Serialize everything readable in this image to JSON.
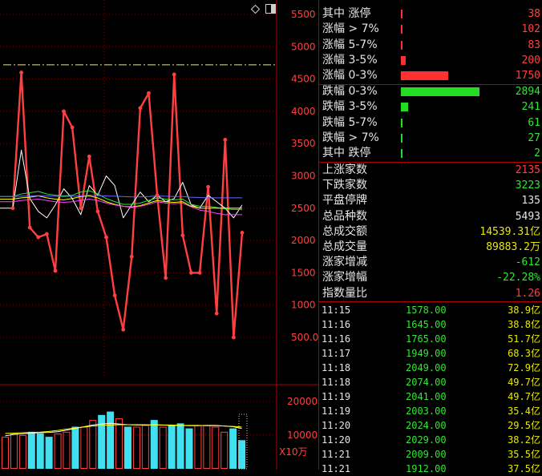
{
  "price_axis": {
    "ticks": [
      "5500",
      "5000",
      "4500",
      "4000",
      "3500",
      "3000",
      "2500",
      "2000",
      "1500",
      "1000",
      "500.0"
    ],
    "values": [
      5500,
      5000,
      4500,
      4000,
      3500,
      3000,
      2500,
      2000,
      1500,
      1000,
      500
    ]
  },
  "volume_axis": {
    "ticks": [
      "20000",
      "10000"
    ],
    "values": [
      20000,
      10000
    ],
    "unit": "X10万"
  },
  "toolbar": {
    "icon_diamond": "diamond-icon",
    "icon_window": "window-icon"
  },
  "chart_data": {
    "type": "line",
    "ylim": [
      0,
      5700
    ],
    "reference_line": 4720,
    "series": [
      {
        "color": "#ff4040",
        "values": [
          2500,
          4600,
          2200,
          2050,
          2100,
          1530,
          4000,
          3750,
          2500,
          3300,
          2450,
          2050,
          1150,
          620,
          1750,
          4050,
          4280,
          2700,
          1420,
          4570,
          2080,
          1500,
          1500,
          2830,
          870,
          3560,
          500,
          2120
        ]
      },
      {
        "color": "#ffffff",
        "values": [
          2500,
          3400,
          2650,
          2450,
          2350,
          2550,
          2800,
          2650,
          2400,
          2850,
          2700,
          3000,
          2850,
          2350,
          2550,
          2750,
          2600,
          2700,
          2600,
          2650,
          2900,
          2550,
          2500,
          2700,
          2600,
          2500,
          2350,
          2550
        ]
      },
      {
        "color": "#33e633",
        "values": [
          2680,
          2720,
          2740,
          2760,
          2720,
          2700,
          2690,
          2700,
          2750,
          2770,
          2720,
          2650,
          2600,
          2560,
          2560,
          2580,
          2620,
          2660,
          2640,
          2630,
          2640,
          2560,
          2530,
          2530,
          2510,
          2490,
          2480,
          2480
        ]
      },
      {
        "color": "#ffff00",
        "values": [
          2640,
          2660,
          2670,
          2690,
          2660,
          2640,
          2630,
          2650,
          2680,
          2690,
          2660,
          2600,
          2560,
          2530,
          2520,
          2540,
          2580,
          2620,
          2600,
          2590,
          2600,
          2530,
          2500,
          2500,
          2500,
          2500,
          2500,
          2500
        ]
      },
      {
        "color": "#ff40ff",
        "values": [
          2600,
          2620,
          2630,
          2640,
          2620,
          2600,
          2590,
          2600,
          2620,
          2640,
          2620,
          2580,
          2550,
          2530,
          2510,
          2530,
          2560,
          2600,
          2580,
          2570,
          2580,
          2520,
          2470,
          2450,
          2420,
          2400,
          2400,
          2400
        ]
      },
      {
        "color": "#6666ff",
        "values": [
          2680,
          2685,
          2690,
          2695,
          2690,
          2685,
          2680,
          2685,
          2690,
          2700,
          2695,
          2690,
          2685,
          2680,
          2675,
          2675,
          2680,
          2690,
          2685,
          2680,
          2680,
          2670,
          2665,
          2660,
          2660,
          2660,
          2660,
          2660
        ]
      }
    ],
    "volume": {
      "ylim": [
        0,
        25000
      ],
      "bars": [
        {
          "value": 9500,
          "color": "red"
        },
        {
          "value": 10500,
          "color": "red"
        },
        {
          "value": 10000,
          "color": "red"
        },
        {
          "value": 11000,
          "color": "cyan"
        },
        {
          "value": 10500,
          "color": "cyan"
        },
        {
          "value": 9500,
          "color": "cyan"
        },
        {
          "value": 10500,
          "color": "red"
        },
        {
          "value": 11000,
          "color": "red"
        },
        {
          "value": 12500,
          "color": "cyan"
        },
        {
          "value": 12500,
          "color": "red"
        },
        {
          "value": 14500,
          "color": "red"
        },
        {
          "value": 16000,
          "color": "cyan"
        },
        {
          "value": 17000,
          "color": "cyan"
        },
        {
          "value": 15000,
          "color": "red"
        },
        {
          "value": 12500,
          "color": "cyan"
        },
        {
          "value": 12500,
          "color": "red"
        },
        {
          "value": 13000,
          "color": "red"
        },
        {
          "value": 14500,
          "color": "cyan"
        },
        {
          "value": 12500,
          "color": "red"
        },
        {
          "value": 13000,
          "color": "cyan"
        },
        {
          "value": 13500,
          "color": "cyan"
        },
        {
          "value": 12000,
          "color": "cyan"
        },
        {
          "value": 13000,
          "color": "red"
        },
        {
          "value": 13000,
          "color": "red"
        },
        {
          "value": 12500,
          "color": "red"
        },
        {
          "value": 11000,
          "color": "red"
        },
        {
          "value": 12000,
          "color": "cyan"
        },
        {
          "value": 8500,
          "color": "cyan"
        }
      ],
      "ma_white": [
        9800,
        10200,
        10400,
        10600,
        10700,
        10800,
        11000,
        11500,
        12000,
        12500,
        13000,
        13300,
        13500,
        13300,
        13100,
        13000,
        13000,
        13100,
        13000,
        12900,
        12900,
        12800,
        12800,
        12900,
        12900,
        12700,
        12500,
        12000
      ],
      "ma_yellow": [
        10500,
        10600,
        10700,
        10800,
        10900,
        11100,
        11400,
        11800,
        12100,
        12400,
        12700,
        12900,
        13000,
        13100,
        13100,
        13100,
        13100,
        13000,
        13000,
        13000,
        12900,
        12900,
        12900,
        12800,
        12800,
        12700,
        12600,
        12400
      ]
    }
  },
  "breadth_up": [
    {
      "label": "其中 涨停",
      "value": "38",
      "fill": 0.008
    },
    {
      "label": "涨幅 > 7%",
      "value": "102",
      "fill": 0.02
    },
    {
      "label": "涨幅 5-7%",
      "value": "83",
      "fill": 0.017
    },
    {
      "label": "涨幅 3-5%",
      "value": "200",
      "fill": 0.06
    },
    {
      "label": "涨幅 0-3%",
      "value": "1750",
      "fill": 0.6
    }
  ],
  "breadth_down": [
    {
      "label": "跌幅 0-3%",
      "value": "2894",
      "fill": 1.0
    },
    {
      "label": "跌幅 3-5%",
      "value": "241",
      "fill": 0.09
    },
    {
      "label": "跌幅 5-7%",
      "value": "61",
      "fill": 0.025
    },
    {
      "label": "跌幅 > 7%",
      "value": "27",
      "fill": 0.012
    },
    {
      "label": "其中 跌停",
      "value": "2",
      "fill": 0.005
    }
  ],
  "stats": [
    {
      "label": "上涨家数",
      "value": "2135",
      "color": "#ff4040"
    },
    {
      "label": "下跌家数",
      "value": "3223",
      "color": "#33e633"
    },
    {
      "label": "平盘停牌",
      "value": "135",
      "color": "#e6e6e6"
    },
    {
      "label": "总品种数",
      "value": "5493",
      "color": "#e6e6e6"
    },
    {
      "label": "总成交额",
      "value": "14539.31亿",
      "color": "#e8e800"
    },
    {
      "label": "总成交量",
      "value": "89883.2万",
      "color": "#e8e800"
    },
    {
      "label": "涨家增减",
      "value": "-612",
      "color": "#33e633"
    },
    {
      "label": "涨家增幅",
      "value": "-22.28%",
      "color": "#33e633"
    },
    {
      "label": "指数量比",
      "value": "1.26",
      "color": "#ff4040"
    }
  ],
  "ticks": [
    {
      "time": "11:15",
      "price": "1578.00",
      "amount": "38.9",
      "unit": "亿"
    },
    {
      "time": "11:16",
      "price": "1645.00",
      "amount": "38.8",
      "unit": "亿"
    },
    {
      "time": "11:16",
      "price": "1765.00",
      "amount": "51.7",
      "unit": "亿"
    },
    {
      "time": "11:17",
      "price": "1949.00",
      "amount": "68.3",
      "unit": "亿"
    },
    {
      "time": "11:18",
      "price": "2049.00",
      "amount": "72.9",
      "unit": "亿"
    },
    {
      "time": "11:18",
      "price": "2074.00",
      "amount": "49.7",
      "unit": "亿"
    },
    {
      "time": "11:19",
      "price": "2041.00",
      "amount": "49.7",
      "unit": "亿"
    },
    {
      "time": "11:19",
      "price": "2003.00",
      "amount": "35.4",
      "unit": "亿"
    },
    {
      "time": "11:20",
      "price": "2024.00",
      "amount": "29.5",
      "unit": "亿"
    },
    {
      "time": "11:20",
      "price": "2029.00",
      "amount": "38.2",
      "unit": "亿"
    },
    {
      "time": "11:21",
      "price": "2009.00",
      "amount": "35.5",
      "unit": "亿"
    },
    {
      "time": "11:21",
      "price": "1912.00",
      "amount": "37.5",
      "unit": "亿"
    }
  ]
}
